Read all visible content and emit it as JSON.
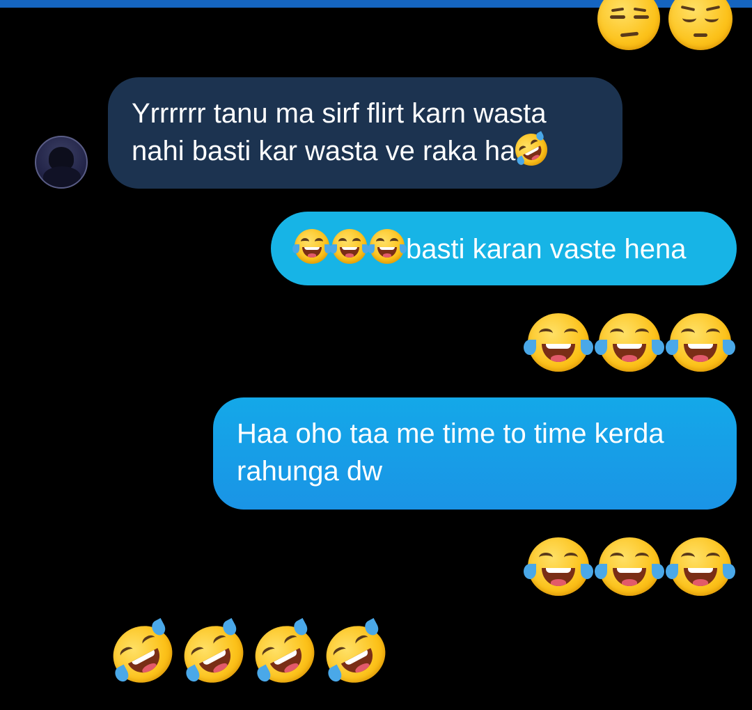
{
  "conversation": {
    "messages": [
      {
        "direction": "incoming",
        "sender_avatar": "contact-avatar",
        "text_line1": "Yrrrrrr tanu ma sirf flirt karn wasta",
        "text_line2": "nahi basti kar wasta ve raka ha",
        "trailing_emoji": "rolling-on-floor-laughing"
      },
      {
        "direction": "outgoing",
        "leading_emojis": [
          "face-with-tears-of-joy",
          "face-with-tears-of-joy",
          "face-with-tears-of-joy"
        ],
        "text": "basti karan vaste hena"
      },
      {
        "direction": "outgoing",
        "type": "emoji-only",
        "emojis": [
          "face-with-tears-of-joy",
          "face-with-tears-of-joy",
          "face-with-tears-of-joy"
        ]
      },
      {
        "direction": "outgoing",
        "text_line1": "Haa oho taa me time to time kerda",
        "text_line2": "rahunga dw"
      },
      {
        "direction": "outgoing",
        "type": "emoji-only",
        "emojis": [
          "face-with-tears-of-joy",
          "face-with-tears-of-joy",
          "face-with-tears-of-joy"
        ]
      },
      {
        "direction": "incoming",
        "type": "emoji-only",
        "emojis": [
          "rolling-on-floor-laughing",
          "rolling-on-floor-laughing",
          "rolling-on-floor-laughing",
          "rolling-on-floor-laughing"
        ]
      }
    ],
    "top_partial_emojis": [
      "unamused-face",
      "pensive-face"
    ]
  },
  "colors": {
    "background": "#000000",
    "incoming_bubble": "#1c3350",
    "outgoing_bubble_cyan": "#17b4e6",
    "outgoing_bubble_blue": "#1a94e6",
    "top_strip": "#1565c0"
  }
}
